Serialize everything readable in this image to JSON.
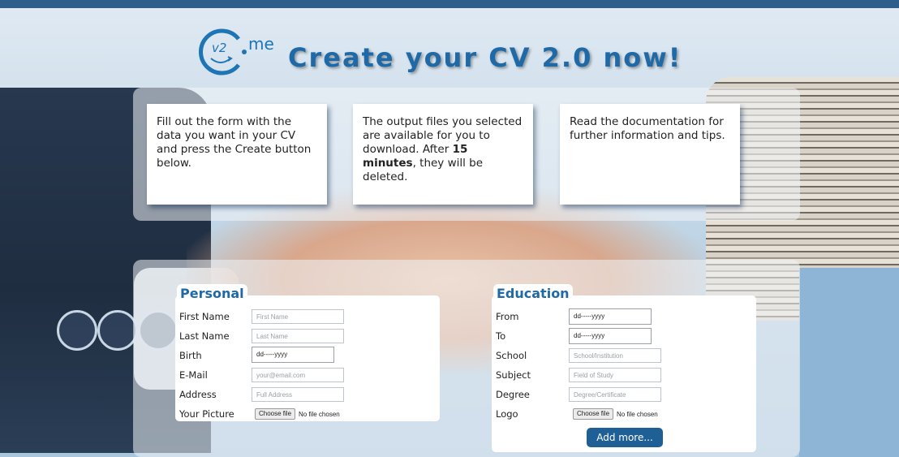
{
  "header": {
    "logo_text": "v2",
    "logo_suffix": "me",
    "title": "Create your CV 2.0 now!"
  },
  "info_cards": [
    {
      "text": "Fill out the form with the data you want in your CV and press the Create button below."
    },
    {
      "text_before": "The output files you selected are available for you to download. After ",
      "bold": "15 minutes",
      "text_after": ", they will be deleted."
    },
    {
      "text": "Read the documentation for further information and tips."
    }
  ],
  "personal": {
    "legend": "Personal",
    "first_name": {
      "label": "First Name",
      "placeholder": "First Name"
    },
    "last_name": {
      "label": "Last Name",
      "placeholder": "Last Name"
    },
    "birth": {
      "label": "Birth",
      "value": "dd-----yyyy"
    },
    "email": {
      "label": "E-Mail",
      "placeholder": "your@email.com"
    },
    "address": {
      "label": "Address",
      "placeholder": "Full Address"
    },
    "picture": {
      "label": "Your Picture",
      "button": "Choose file",
      "status": "No file chosen"
    }
  },
  "education": {
    "legend": "Education",
    "from": {
      "label": "From",
      "value": "dd-----yyyy"
    },
    "to": {
      "label": "To",
      "value": "dd-----yyyy"
    },
    "school": {
      "label": "School",
      "placeholder": "School/Institution"
    },
    "subject": {
      "label": "Subject",
      "placeholder": "Field of Study"
    },
    "degree": {
      "label": "Degree",
      "placeholder": "Degree/Certificate"
    },
    "logo": {
      "label": "Logo",
      "button": "Choose file",
      "status": "No file chosen"
    },
    "add_more": "Add more..."
  },
  "colors": {
    "accent": "#1f6aa6",
    "button": "#1e5f95",
    "top_bar": "#2e5f8a"
  }
}
